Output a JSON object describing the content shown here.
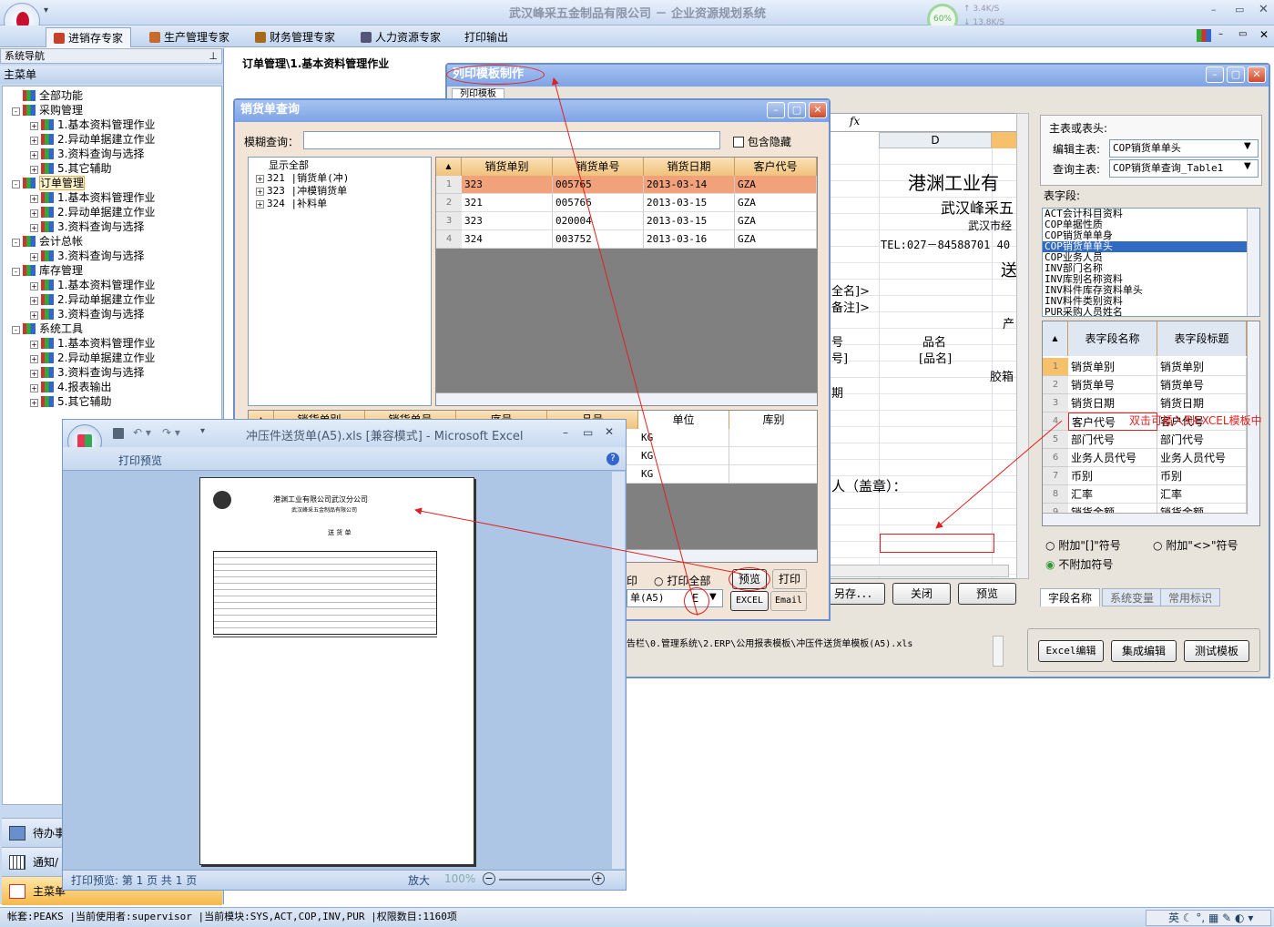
{
  "app": {
    "title": "武汉峰采五金制品有限公司 － 企业资源规划系统",
    "net_percent": "60%",
    "net_up": "3.4K/S",
    "net_down": "13.8K/S"
  },
  "menu": [
    {
      "label": "进销存专家",
      "color": "#c8402a"
    },
    {
      "label": "生产管理专家",
      "color": "#c86a2a"
    },
    {
      "label": "财务管理专家",
      "color": "#a86a1a"
    },
    {
      "label": "人力资源专家",
      "color": "#555577"
    },
    {
      "label": "打印输出",
      "color": ""
    }
  ],
  "nav": {
    "header": "系统导航",
    "main_menu": "主菜单",
    "tree": [
      {
        "label": "全部功能",
        "level": 1,
        "pm": ""
      },
      {
        "label": "采购管理",
        "level": 0,
        "pm": "-"
      },
      {
        "label": "1.基本资料管理作业",
        "level": 2,
        "pm": "+"
      },
      {
        "label": "2.异动单据建立作业",
        "level": 2,
        "pm": "+"
      },
      {
        "label": "3.资料查询与选择",
        "level": 2,
        "pm": "+"
      },
      {
        "label": "5.其它辅助",
        "level": 2,
        "pm": "+"
      },
      {
        "label": "订单管理",
        "level": 0,
        "pm": "-",
        "selected": true
      },
      {
        "label": "1.基本资料管理作业",
        "level": 2,
        "pm": "+"
      },
      {
        "label": "2.异动单据建立作业",
        "level": 2,
        "pm": "+"
      },
      {
        "label": "3.资料查询与选择",
        "level": 2,
        "pm": "+"
      },
      {
        "label": "会计总帐",
        "level": 0,
        "pm": "-"
      },
      {
        "label": "3.资料查询与选择",
        "level": 2,
        "pm": "+"
      },
      {
        "label": "库存管理",
        "level": 0,
        "pm": "-"
      },
      {
        "label": "1.基本资料管理作业",
        "level": 2,
        "pm": "+"
      },
      {
        "label": "2.异动单据建立作业",
        "level": 2,
        "pm": "+"
      },
      {
        "label": "3.资料查询与选择",
        "level": 2,
        "pm": "+"
      },
      {
        "label": "系统工具",
        "level": 0,
        "pm": "-"
      },
      {
        "label": "1.基本资料管理作业",
        "level": 2,
        "pm": "+"
      },
      {
        "label": "2.异动单据建立作业",
        "level": 2,
        "pm": "+"
      },
      {
        "label": "3.资料查询与选择",
        "level": 2,
        "pm": "+"
      },
      {
        "label": "4.报表输出",
        "level": 2,
        "pm": "+"
      },
      {
        "label": "5.其它辅助",
        "level": 2,
        "pm": "+"
      }
    ],
    "bottom": [
      "待办事",
      "通知/",
      "主菜单"
    ]
  },
  "breadcrumb": "订单管理\\1.基本资料管理作业",
  "template_win": {
    "title": "列印模板制作",
    "tab": "列印模板",
    "sheet_col": "D",
    "sheet_lines": [
      "港渊工业有",
      "武汉峰采五",
      "武汉市经",
      "TEL:027－84588701  40",
      "送",
      "全名]>",
      "备注]>",
      "产",
      "号",
      "品名",
      "号]",
      "[品名]",
      "胶箱",
      "期",
      "人（盖章）："
    ],
    "btn_save": "另存．．．",
    "btn_close": "关闭",
    "btn_preview": "预览",
    "path": "告栏\\0.管理系统\\2.ERP\\公用报表模板\\冲压件送货单模板(A5).xls",
    "btn_excel_edit": "Excel编辑",
    "btn_integrated": "集成编辑",
    "btn_test": "测试模板",
    "right": {
      "group_label": "主表或表头:",
      "edit_table_label": "编辑主表:",
      "edit_table_value": "COP销货单单头",
      "query_table_label": "查询主表:",
      "query_table_value": "COP销货单查询_Table1",
      "fields_label": "表字段:",
      "field_list": [
        "ACT会计科目资料",
        "COP单据性质",
        "COP销货单单身",
        "COP销货单单头",
        "COP业务人员",
        "INV部门名称",
        "INV库别名称资料",
        "INV料件库存资料单头",
        "INV料件类别资料",
        "PUR采购人员姓名"
      ],
      "field_list_selected": 3,
      "grid_headers": [
        "表字段名称",
        "表字段标题"
      ],
      "grid_rows": [
        [
          "销货单别",
          "销货单别"
        ],
        [
          "销货单号",
          "销货单号"
        ],
        [
          "销货日期",
          "销货日期"
        ],
        [
          "客户代号",
          "客户代号"
        ],
        [
          "部门代号",
          "部门代号"
        ],
        [
          "业务人员代号",
          "业务人员代号"
        ],
        [
          "币别",
          "币别"
        ],
        [
          "汇率",
          "汇率"
        ],
        [
          "销货金额",
          "销货金额"
        ]
      ],
      "annotation": "双击可插入到EXCEL模板中",
      "radio1": "附加\"[]\"符号",
      "radio2": "附加\"<>\"符号",
      "radio3": "不附加符号",
      "tabs": [
        "字段名称",
        "系统变量",
        "常用标识"
      ]
    }
  },
  "query_win": {
    "title": "销货单查询",
    "fuzzy_label": "模糊查询：",
    "fuzzy_value": "",
    "include_hidden": "包含隐藏",
    "tree": [
      "显示全部",
      "321 |销货单(冲)",
      "323 |冲模销货单",
      "324 |补料单"
    ],
    "headers": [
      "销货单别",
      "销货单号",
      "销货日期",
      "客户代号"
    ],
    "rows": [
      [
        "323",
        "005765",
        "2013-03-14",
        "GZA"
      ],
      [
        "321",
        "005766",
        "2013-03-15",
        "GZA"
      ],
      [
        "323",
        "020004",
        "2013-03-15",
        "GZA"
      ],
      [
        "324",
        "003752",
        "2013-03-16",
        "GZA"
      ]
    ],
    "detail_headers": [
      "销货单别",
      "销货单号",
      "序号",
      "品号",
      "单位",
      "库别"
    ],
    "detail_units": [
      "KG",
      "KG",
      "KG"
    ],
    "print_label": "印",
    "print_all": "打印全部",
    "btn_preview": "预览",
    "btn_print": "打印",
    "template_combo": "单(A5)",
    "template_code": "E",
    "btn_excel": "EXCEL",
    "btn_email": "Email"
  },
  "excel_win": {
    "title": "冲压件送货单(A5).xls  [兼容模式] - Microsoft Excel",
    "ribbon_tab": "打印预览",
    "page_company": "港渊工业有限公司武汉分公司",
    "page_sub": "武汉峰采五金制品有限公司",
    "page_doc": "送  货  单",
    "status": "打印预览: 第 1 页  共 1 页",
    "zoom_label": "放大",
    "zoom_value": "100%"
  },
  "statusbar": "帐套:PEAKS |当前使用者:supervisor  |当前模块:SYS,ACT,COP,INV,PUR |权限数目:1160项",
  "tray": [
    "英"
  ]
}
